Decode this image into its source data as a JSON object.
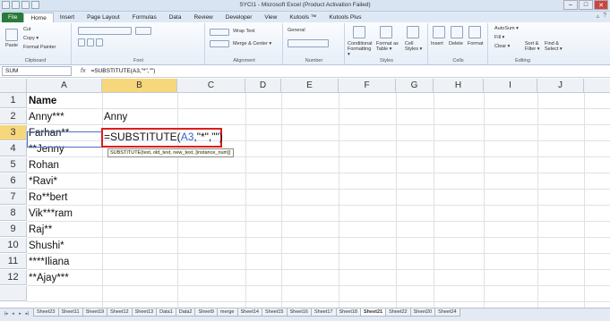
{
  "window": {
    "title": "SYCI1 - Microsoft Excel (Product Activation Failed)"
  },
  "ribbon_tabs": [
    "File",
    "Home",
    "Insert",
    "Page Layout",
    "Formulas",
    "Data",
    "Review",
    "Developer",
    "View",
    "Kutools ™",
    "Kutools Plus"
  ],
  "ribbon": {
    "clipboard": {
      "label": "Clipboard",
      "paste": "Paste",
      "cut": "Cut",
      "copy": "Copy ▾",
      "format_painter": "Format Painter"
    },
    "font": {
      "label": "Font"
    },
    "alignment": {
      "label": "Alignment",
      "wrap_text": "Wrap Text",
      "merge": "Merge & Center ▾"
    },
    "number": {
      "label": "Number",
      "format": "General"
    },
    "styles": {
      "label": "Styles",
      "conditional": "Conditional Formatting ▾",
      "format_table": "Format as Table ▾",
      "cell_styles": "Cell Styles ▾"
    },
    "cells": {
      "label": "Cells",
      "insert": "Insert",
      "delete": "Delete",
      "format": "Format"
    },
    "editing": {
      "label": "Editing",
      "autosum": "AutoSum ▾",
      "fill": "Fill ▾",
      "clear": "Clear ▾",
      "sort": "Sort & Filter ▾",
      "find": "Find & Select ▾"
    }
  },
  "formula_bar": {
    "name_box": "SUM",
    "fx": "fx",
    "content": "=SUBSTITUTE(A3,\"*\",\"\")"
  },
  "columns": [
    "A",
    "B",
    "C",
    "D",
    "E",
    "F",
    "G",
    "H",
    "I",
    "J"
  ],
  "rows": [
    "1",
    "2",
    "3",
    "4",
    "5",
    "6",
    "7",
    "8",
    "9",
    "10",
    "11",
    "12"
  ],
  "cells": {
    "A1": "Name",
    "A2": "Anny***",
    "A3": "Farhan**",
    "A4": "**Jenny",
    "A5": "Rohan",
    "A6": "*Ravi*",
    "A7": "Ro**bert",
    "A8": "Vik***ram",
    "A9": "Raj**",
    "A10": "Shushi*",
    "A11": "****Iliana",
    "A12": "**Ajay***",
    "B2": "Anny"
  },
  "editing_formula": {
    "prefix": "=SUBSTITUTE(",
    "ref": "A3",
    "suffix": ",\"*\",\"\")"
  },
  "tooltip": "SUBSTITUTE(text, old_text, new_text, [instance_num])",
  "sheet_tabs": [
    "Sheet23",
    "Sheet11",
    "Sheet19",
    "Sheet12",
    "Sheet13",
    "Data1",
    "Data2",
    "Sheet9",
    "merge",
    "Sheet14",
    "Sheet15",
    "Sheet16",
    "Sheet17",
    "Sheet18",
    "Sheet21",
    "Sheet22",
    "Sheet20",
    "Sheet24"
  ],
  "active_sheet": "Sheet21",
  "colors": {
    "selection_header": "#f7d77c",
    "highlight_border": "#e01c1c",
    "file_tab": "#2a7a3a",
    "reference_blue": "#3366cc"
  }
}
